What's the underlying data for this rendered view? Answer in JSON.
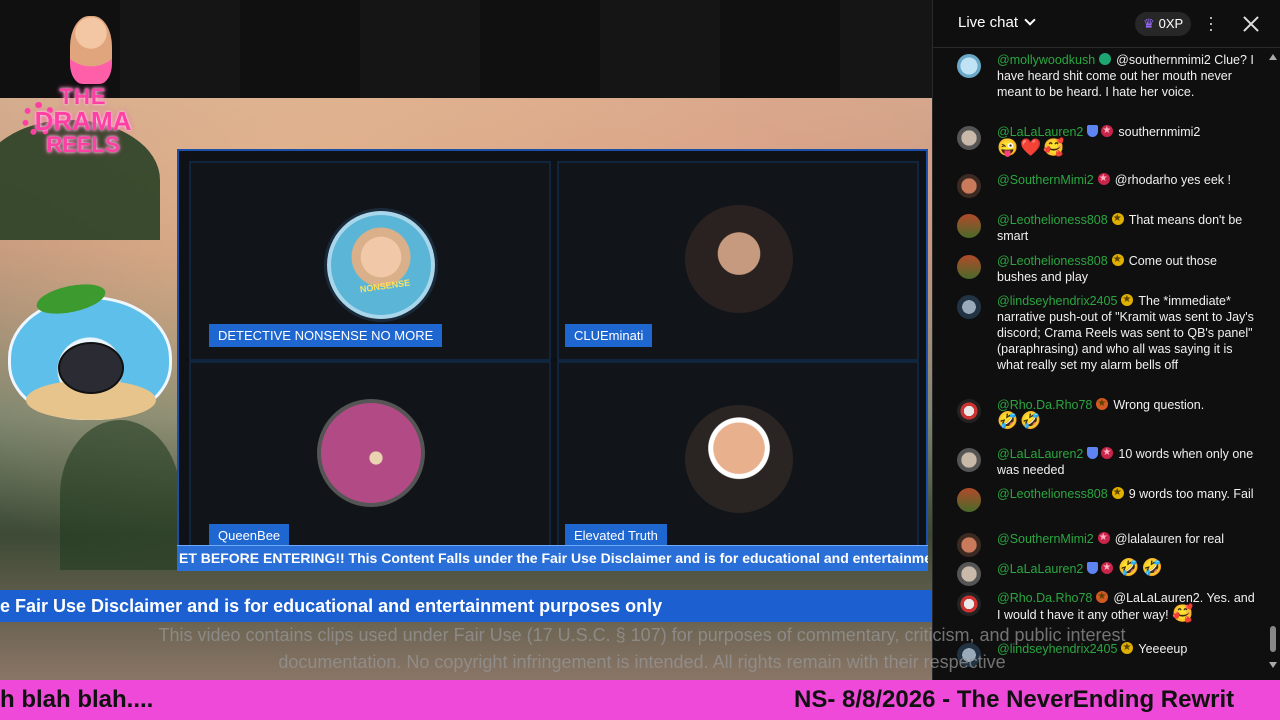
{
  "logo": {
    "line1": "THE",
    "line2": "DRAMA",
    "line3": "REELS"
  },
  "panel": {
    "guests": [
      {
        "name": "DETECTIVE NONSENSE NO MORE",
        "avatar_text": "NONSENSE"
      },
      {
        "name": "CLUEminati"
      },
      {
        "name": "QueenBee"
      },
      {
        "name": "Elevated Truth"
      }
    ]
  },
  "tickers": {
    "inner": "ET BEFORE ENTERING!! This Content Falls under the Fair Use Disclaimer and is for educational and entertainment purposes only",
    "outer": "e Fair Use Disclaimer and is for educational and entertainment purposes only",
    "disclaimer": "This video contains clips used under Fair Use (17 U.S.C. § 107) for purposes of commentary, criticism, and public interest documentation. No copyright infringement is intended. All rights remain with their respective",
    "bottom_left": "h blah blah....",
    "bottom_right": "NS- 8/8/2026 - The NeverEnding Rewrit"
  },
  "chat": {
    "title": "Live chat",
    "xp_label": "0XP",
    "messages": [
      {
        "author": "@mollywoodkush",
        "text": "@southernmimi2 Clue? I have heard shit come out her mouth never meant to be heard. I hate her voice."
      },
      {
        "author": "@LaLaLauren2",
        "text": "southernmimi2",
        "emoji": "😜❤️🥰"
      },
      {
        "author": "@SouthernMimi2",
        "text": "@rhodarho yes eek !"
      },
      {
        "author": "@Leothelioness808",
        "text": "That means don't be smart"
      },
      {
        "author": "@Leothelioness808",
        "text": "Come out those bushes and play"
      },
      {
        "author": "@lindseyhendrix2405",
        "text": "The *immediate* narrative push-out of \"Kramit was sent to Jay's discord; Crama Reels was sent to QB's panel\" (paraphrasing) and who all was saying it is what really set my alarm bells off"
      },
      {
        "author": "@Rho.Da.Rho78",
        "text": "Wrong question.",
        "emoji": "🤣🤣"
      },
      {
        "author": "@LaLaLauren2",
        "text": "10 words when only one was needed"
      },
      {
        "author": "@Leothelioness808",
        "text": "9 words too many. Fail"
      },
      {
        "author": "@SouthernMimi2",
        "text": "@lalalauren for real"
      },
      {
        "author": "@LaLaLauren2",
        "text": "",
        "emoji": "🤣🤣"
      },
      {
        "author": "@Rho.Da.Rho78",
        "text": "@LaLaLauren2. Yes. and I would t have it any other way!",
        "emoji": "🥰"
      },
      {
        "author": "@lindseyhendrix2405",
        "text": "Yeeeeup"
      }
    ]
  },
  "colors": {
    "accent_pink": "#ee49d8",
    "ticker_blue": "#1b5fd0",
    "author_green": "#2ba640"
  }
}
